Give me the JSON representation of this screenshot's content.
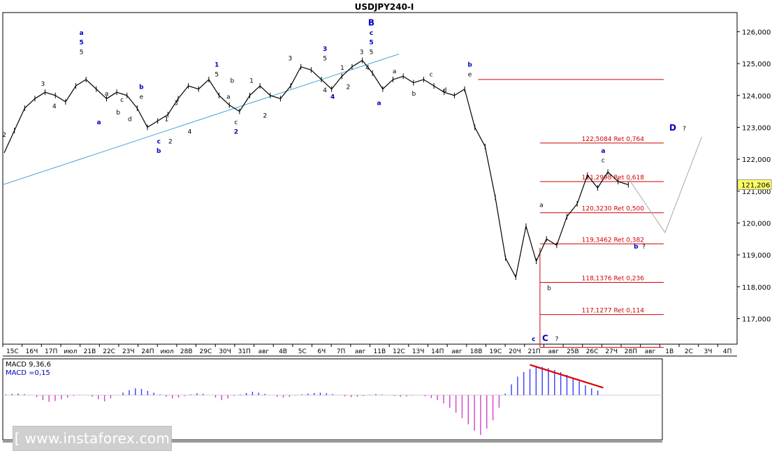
{
  "chart_data": {
    "type": "line",
    "title": "USDJPY240-I",
    "instrument": "USDJPY",
    "timeframe": "240",
    "y_axis": {
      "min": 116.2,
      "max": 126.6,
      "tick_labels": [
        "126,000",
        "125,000",
        "124,000",
        "123,000",
        "122,000",
        "121,000",
        "120,000",
        "119,000",
        "118,000",
        "117,000"
      ],
      "tick_values": [
        126,
        125,
        124,
        123,
        122,
        121,
        120,
        119,
        118,
        117
      ],
      "current_price_label": "121,206",
      "current_price": 121.206
    },
    "x_axis": {
      "tick_labels": [
        "15С",
        "16Ч",
        "17П",
        "июл",
        "21В",
        "22С",
        "23Ч",
        "24П",
        "июл",
        "28В",
        "29С",
        "30Ч",
        "31П",
        "авг",
        "4В",
        "5С",
        "6Ч",
        "7П",
        "авг",
        "11В",
        "12С",
        "13Ч",
        "14П",
        "авг",
        "18В",
        "19С",
        "20Ч",
        "21П",
        "авг",
        "25В",
        "26С",
        "27Ч",
        "28П",
        "авг",
        "1В",
        "2С",
        "3Ч",
        "4П"
      ]
    },
    "price_series": {
      "name": "USDJPY240-I",
      "values": [
        122.2,
        122.9,
        123.6,
        123.9,
        124.1,
        124.0,
        123.8,
        124.3,
        124.5,
        124.2,
        123.9,
        124.1,
        124.0,
        123.6,
        123.0,
        123.2,
        123.4,
        123.9,
        124.3,
        124.2,
        124.5,
        124.0,
        123.7,
        123.5,
        124.0,
        124.3,
        124.0,
        123.9,
        124.3,
        124.9,
        124.8,
        124.5,
        124.2,
        124.6,
        124.9,
        125.1,
        124.7,
        124.2,
        124.5,
        124.6,
        124.4,
        124.5,
        124.3,
        124.1,
        124.0,
        124.2,
        123.0,
        122.4,
        120.8,
        118.9,
        118.3,
        119.9,
        118.8,
        119.5,
        119.3,
        120.2,
        120.6,
        121.5,
        121.1,
        121.6,
        121.3,
        121.2
      ],
      "x_start_category_index": 0,
      "x_end_category_index": 32.3
    },
    "trend_line": {
      "from": {
        "x": 0,
        "y": 121.2
      },
      "to": {
        "x": 20,
        "y": 125.3
      }
    },
    "levels": [
      {
        "value": 124.5,
        "label": ""
      },
      {
        "value": 122.5084,
        "label": "122,5084 Ret 0,764"
      },
      {
        "value": 121.2998,
        "label": "121,2998 Ret 0,618"
      },
      {
        "value": 120.323,
        "label": "120,3230 Ret 0,500"
      },
      {
        "value": 119.3462,
        "label": "119,3462 Ret 0,382"
      },
      {
        "value": 118.1376,
        "label": "118,1376 Ret 0,236"
      },
      {
        "value": 117.1277,
        "label": "117,1277 Ret 0,114"
      },
      {
        "value": 116.1,
        "label": ""
      }
    ],
    "forecast_path": [
      {
        "x": 32.3,
        "y": 121.4
      },
      {
        "x": 34.2,
        "y": 119.7
      },
      {
        "x": 36.1,
        "y": 122.7
      }
    ],
    "wave_labels": [
      {
        "x": 0.0,
        "y": 122.7,
        "text": "2",
        "color": "#000000"
      },
      {
        "x": 2.0,
        "y": 124.3,
        "text": "3",
        "color": "#000000"
      },
      {
        "x": 2.6,
        "y": 123.6,
        "text": "4",
        "color": "#000000"
      },
      {
        "x": 4.0,
        "y": 125.3,
        "text": "5",
        "color": "#000000"
      },
      {
        "x": 4.0,
        "y": 125.6,
        "text": "5",
        "color": "#0000c0"
      },
      {
        "x": 4.0,
        "y": 125.9,
        "text": "a",
        "color": "#0000c0"
      },
      {
        "x": 4.9,
        "y": 123.1,
        "text": "a",
        "color": "#0000c0"
      },
      {
        "x": 5.3,
        "y": 124.0,
        "text": "a",
        "color": "#000000"
      },
      {
        "x": 5.9,
        "y": 123.4,
        "text": "b",
        "color": "#000000"
      },
      {
        "x": 6.1,
        "y": 123.8,
        "text": "c",
        "color": "#000000"
      },
      {
        "x": 6.5,
        "y": 123.2,
        "text": "d",
        "color": "#000000"
      },
      {
        "x": 7.1,
        "y": 123.9,
        "text": "e",
        "color": "#000000"
      },
      {
        "x": 7.1,
        "y": 124.2,
        "text": "b",
        "color": "#0000c0"
      },
      {
        "x": 8.0,
        "y": 122.5,
        "text": "c",
        "color": "#0000c0"
      },
      {
        "x": 8.0,
        "y": 122.2,
        "text": "b",
        "color": "#0000c0"
      },
      {
        "x": 8.4,
        "y": 123.2,
        "text": "1",
        "color": "#000000"
      },
      {
        "x": 8.6,
        "y": 122.5,
        "text": "2",
        "color": "#000000"
      },
      {
        "x": 8.9,
        "y": 123.7,
        "text": "3",
        "color": "#000000"
      },
      {
        "x": 9.6,
        "y": 122.8,
        "text": "4",
        "color": "#000000"
      },
      {
        "x": 11.0,
        "y": 124.6,
        "text": "5",
        "color": "#000000"
      },
      {
        "x": 11.0,
        "y": 124.9,
        "text": "1",
        "color": "#0000c0"
      },
      {
        "x": 11.6,
        "y": 123.9,
        "text": "a",
        "color": "#000000"
      },
      {
        "x": 11.8,
        "y": 124.4,
        "text": "b",
        "color": "#000000"
      },
      {
        "x": 12.0,
        "y": 123.1,
        "text": "c",
        "color": "#000000"
      },
      {
        "x": 12.0,
        "y": 122.8,
        "text": "2",
        "color": "#0000c0"
      },
      {
        "x": 12.8,
        "y": 124.4,
        "text": "1",
        "color": "#000000"
      },
      {
        "x": 13.5,
        "y": 123.3,
        "text": "2",
        "color": "#000000"
      },
      {
        "x": 14.8,
        "y": 125.1,
        "text": "3",
        "color": "#000000"
      },
      {
        "x": 16.6,
        "y": 125.1,
        "text": "5",
        "color": "#000000"
      },
      {
        "x": 16.6,
        "y": 125.4,
        "text": "3",
        "color": "#0000c0"
      },
      {
        "x": 16.6,
        "y": 124.1,
        "text": "4",
        "color": "#000000"
      },
      {
        "x": 17.0,
        "y": 123.9,
        "text": "4",
        "color": "#0000c0"
      },
      {
        "x": 17.5,
        "y": 124.8,
        "text": "1",
        "color": "#000000"
      },
      {
        "x": 17.8,
        "y": 124.2,
        "text": "2",
        "color": "#000000"
      },
      {
        "x": 18.5,
        "y": 125.3,
        "text": "3",
        "color": "#000000"
      },
      {
        "x": 18.8,
        "y": 124.8,
        "text": "4",
        "color": "#000000"
      },
      {
        "x": 19.0,
        "y": 125.3,
        "text": "5",
        "color": "#000000"
      },
      {
        "x": 19.0,
        "y": 125.6,
        "text": "5",
        "color": "#0000c0"
      },
      {
        "x": 19.0,
        "y": 125.9,
        "text": "c",
        "color": "#0000c0"
      },
      {
        "x": 19.0,
        "y": 126.2,
        "text": "B",
        "color": "#0000c0"
      },
      {
        "x": 19.4,
        "y": 123.7,
        "text": "a",
        "color": "#0000c0"
      },
      {
        "x": 20.2,
        "y": 124.7,
        "text": "a",
        "color": "#000000"
      },
      {
        "x": 21.2,
        "y": 124.0,
        "text": "b",
        "color": "#000000"
      },
      {
        "x": 22.1,
        "y": 124.6,
        "text": "c",
        "color": "#000000"
      },
      {
        "x": 22.8,
        "y": 124.1,
        "text": "d",
        "color": "#000000"
      },
      {
        "x": 24.1,
        "y": 124.6,
        "text": "e",
        "color": "#000000"
      },
      {
        "x": 24.1,
        "y": 124.9,
        "text": "b",
        "color": "#0000c0"
      },
      {
        "x": 27.4,
        "y": 116.3,
        "text": "c",
        "color": "#0000c0"
      },
      {
        "x": 28.0,
        "y": 116.3,
        "text": "C",
        "color": "#0000c0"
      },
      {
        "x": 28.6,
        "y": 116.3,
        "text": "?",
        "color": "#000000"
      },
      {
        "x": 27.8,
        "y": 120.5,
        "text": "a",
        "color": "#000000"
      },
      {
        "x": 28.2,
        "y": 117.9,
        "text": "b",
        "color": "#000000"
      },
      {
        "x": 31.0,
        "y": 121.9,
        "text": "c",
        "color": "#000000"
      },
      {
        "x": 31.0,
        "y": 122.2,
        "text": "a",
        "color": "#0000c0"
      },
      {
        "x": 32.7,
        "y": 119.2,
        "text": "b",
        "color": "#0000c0"
      },
      {
        "x": 33.1,
        "y": 119.2,
        "text": "?",
        "color": "#000000"
      },
      {
        "x": 34.6,
        "y": 122.9,
        "text": "D",
        "color": "#0000c0"
      },
      {
        "x": 35.2,
        "y": 122.9,
        "text": "?",
        "color": "#000000"
      }
    ],
    "macd": {
      "label_1": "MACD 9,36,6",
      "label_2": "MACD =0,15",
      "histogram_color_positive": "#3a3aff",
      "histogram_color_negative": "#d040d0",
      "values": [
        0.02,
        0.04,
        0.05,
        0.03,
        0.0,
        -0.05,
        -0.12,
        -0.16,
        -0.14,
        -0.1,
        -0.06,
        -0.02,
        0.01,
        0.0,
        -0.04,
        -0.1,
        -0.15,
        -0.08,
        0.0,
        0.08,
        0.16,
        0.22,
        0.2,
        0.14,
        0.08,
        0.02,
        -0.04,
        -0.08,
        -0.06,
        -0.02,
        0.02,
        0.06,
        0.04,
        0.0,
        -0.06,
        -0.12,
        -0.08,
        -0.02,
        0.02,
        0.07,
        0.11,
        0.08,
        0.04,
        0.0,
        -0.04,
        -0.06,
        -0.04,
        -0.01,
        0.02,
        0.05,
        0.07,
        0.08,
        0.06,
        0.03,
        0.0,
        -0.03,
        -0.05,
        -0.04,
        -0.02,
        0.01,
        0.03,
        0.02,
        0.0,
        -0.02,
        -0.04,
        -0.03,
        -0.01,
        0.0,
        -0.03,
        -0.07,
        -0.12,
        -0.2,
        -0.3,
        -0.42,
        -0.55,
        -0.7,
        -0.85,
        -0.95,
        -0.8,
        -0.6,
        -0.3,
        0.05,
        0.35,
        0.6,
        0.75,
        0.85,
        0.9,
        0.92,
        0.88,
        0.82,
        0.75,
        0.66,
        0.55,
        0.45,
        0.32,
        0.22,
        0.15
      ],
      "ylim": [
        -1.0,
        1.0
      ],
      "trend_line": {
        "from_index": 85,
        "to_index": 96
      }
    }
  },
  "watermark": {
    "text": "[ www.instaforex.com ]"
  }
}
